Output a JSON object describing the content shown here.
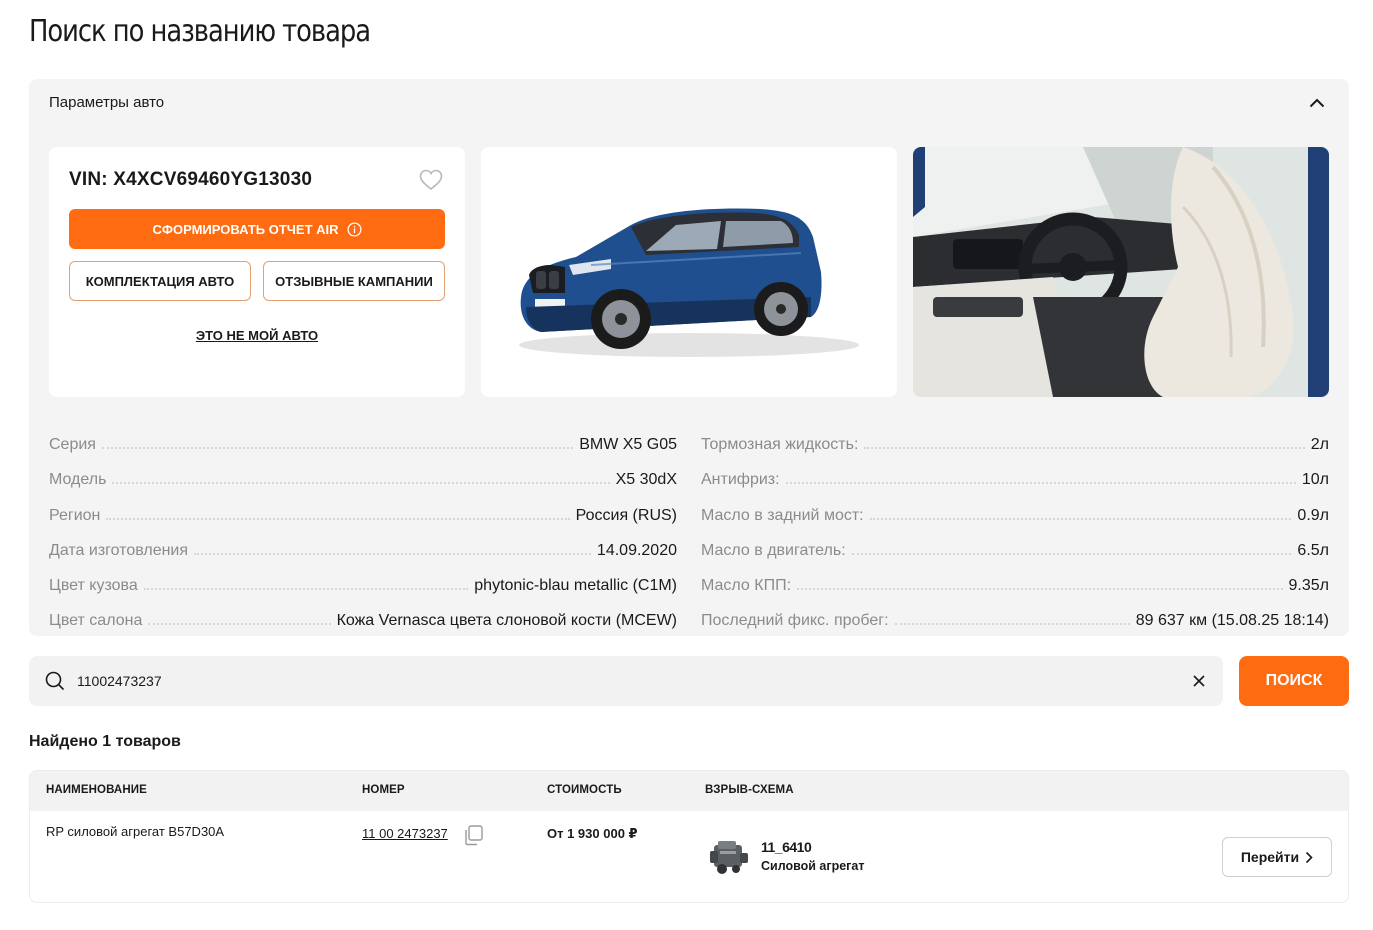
{
  "page": {
    "title": "Поиск по названию товара"
  },
  "params": {
    "header": "Параметры авто",
    "vin": "VIN: X4XCV69460YG13030",
    "report_button": "СФОРМИРОВАТЬ ОТЧЕТ AIR",
    "equipment_button": "КОМПЛЕКТАЦИЯ АВТО",
    "recall_button": "ОТЗЫВНЫЕ КАМПАНИИ",
    "not_my_car": "ЭТО НЕ МОЙ АВТО",
    "specs_left": [
      {
        "label": "Серия",
        "value": "BMW X5 G05"
      },
      {
        "label": "Модель",
        "value": "X5 30dX"
      },
      {
        "label": "Регион",
        "value": "Россия (RUS)"
      },
      {
        "label": "Дата изготовления",
        "value": "14.09.2020"
      },
      {
        "label": "Цвет кузова",
        "value": "phytonic-blau metallic (C1M)"
      },
      {
        "label": "Цвет салона",
        "value": "Кожа Vernasca цвета слоновой кости (MCEW)"
      }
    ],
    "specs_right": [
      {
        "label": "Тормозная жидкость:",
        "value": "2л"
      },
      {
        "label": "Антифриз:",
        "value": "10л"
      },
      {
        "label": "Масло в задний мост:",
        "value": "0.9л"
      },
      {
        "label": "Масло в двигатель:",
        "value": "6.5л"
      },
      {
        "label": "Масло КПП:",
        "value": "9.35л"
      },
      {
        "label": "Последний фикс. пробег:",
        "value": "89 637 км  (15.08.25 18:14)"
      }
    ]
  },
  "search": {
    "value": "11002473237",
    "button": "ПОИСК"
  },
  "results": {
    "found_text": "Найдено 1 товаров",
    "columns": [
      "НАИМЕНОВАНИЕ",
      "НОМЕР",
      "СТОИМОСТЬ",
      "ВЗРЫВ-СХЕМА"
    ],
    "rows": [
      {
        "name": "RP силовой агрегат B57D30A",
        "number": "11 00 2473237",
        "price": "От 1 930 000 ₽",
        "scheme_code": "11_6410",
        "scheme_name": "Силовой агрегат",
        "action": "Перейти"
      }
    ]
  },
  "colors": {
    "accent": "#ff6b10",
    "panel_bg": "#f4f4f4",
    "car_blue": "#1f4f8e"
  }
}
